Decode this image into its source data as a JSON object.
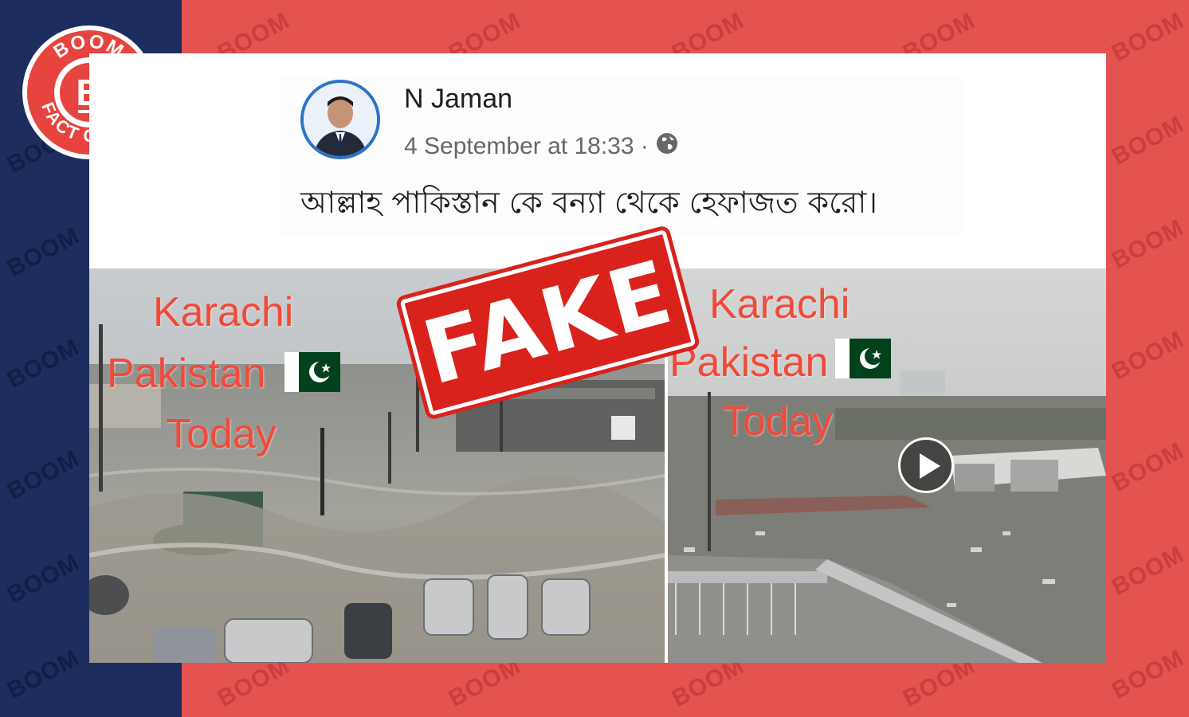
{
  "brand": {
    "name": "BOOM",
    "tagline": "FACT CHECK",
    "letter": "B",
    "watermark": "BOOM"
  },
  "colors": {
    "background_red": "#e45350",
    "left_band_navy": "#1d2d5e",
    "stamp_red": "#d9221c",
    "avatar_ring_blue": "#2d73c6"
  },
  "post": {
    "author": "N Jaman",
    "timestamp": "4 September at 18:33 ·",
    "privacy_icon": "globe-icon",
    "text": "আল্লাহ পাকিস্তান কে বন্যা থেকে হেফাজত করো।"
  },
  "images": {
    "left": {
      "line1": "Karachi",
      "line2": "Pakistan",
      "line3": "Today",
      "flag_icon": "pakistan-flag-icon"
    },
    "right": {
      "line1": "Karachi",
      "line2": "Pakistan",
      "line3": "Today",
      "flag_icon": "pakistan-flag-icon",
      "play_icon": "play-icon"
    }
  },
  "stamp": {
    "label": "FAKE"
  }
}
